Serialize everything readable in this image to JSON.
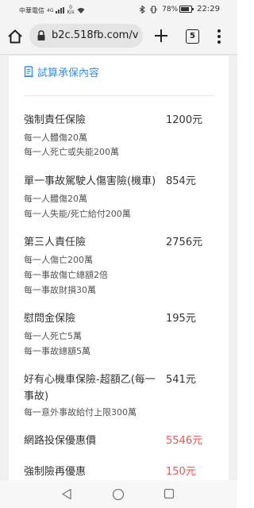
{
  "status_bar": {
    "carrier": "中華電信",
    "network": "4G",
    "speed_value": "0",
    "speed_unit": "K/s",
    "battery": "78%",
    "time": "22:29"
  },
  "browser": {
    "url": "b2c.518fb.com/v",
    "tab_count": "5",
    "icons": [
      "home-icon",
      "lock-icon",
      "plus-icon",
      "tabs-icon",
      "more-vert-icon"
    ]
  },
  "section": {
    "title": "試算承保內容",
    "icon": "document-icon",
    "accent_color": "#3a8fd8"
  },
  "rows": [
    {
      "label": "強制責任保險",
      "amount": "1200元",
      "notes": [
        "每一人體傷20萬",
        "每一人死亡或失能200萬"
      ]
    },
    {
      "label": "單一事故駕駛人傷害險(機車)",
      "amount": "854元",
      "notes": [
        "每一人體傷20萬",
        "每一人失能/死亡給付200萬"
      ]
    },
    {
      "label": "第三人責任險",
      "amount": "2756元",
      "notes": [
        "每一人傷亡200萬",
        "每一事故傷亡總額2倍",
        "每一事故財損30萬"
      ]
    },
    {
      "label": "慰問金保險",
      "amount": "195元",
      "notes": [
        "每一人死亡5萬",
        "每一事故總額5萬"
      ]
    },
    {
      "label": "好有心機車保險-超額乙(每一事故)",
      "amount": "541元",
      "notes": [
        "每一意外事故給付上限300萬"
      ]
    },
    {
      "label": "網路投保優惠價",
      "amount": "5546元",
      "notes": []
    },
    {
      "label": "強制險再優惠",
      "amount": "150元",
      "notes": []
    }
  ],
  "price_color": "#e8554e",
  "nav": {
    "icons": [
      "back-icon",
      "home-circle-icon",
      "recent-apps-icon"
    ]
  }
}
